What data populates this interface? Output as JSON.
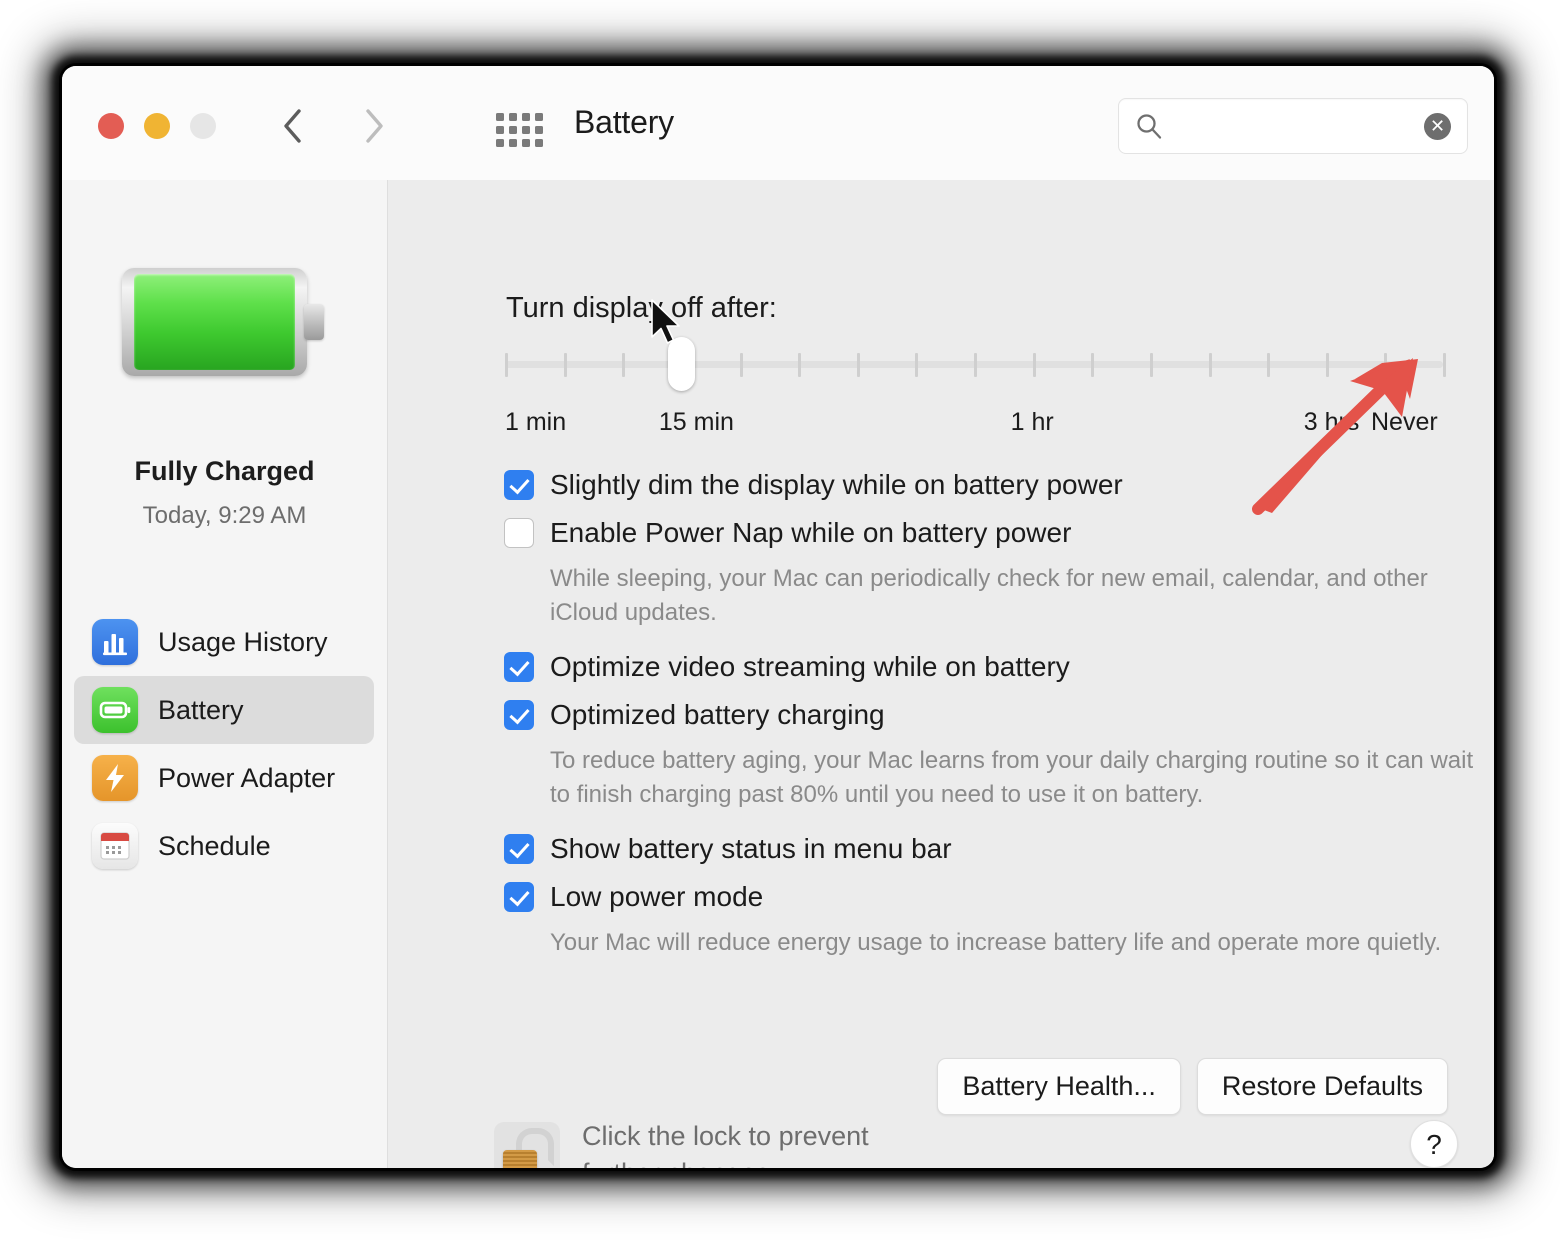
{
  "window": {
    "title": "Battery",
    "traffic_lights": [
      {
        "name": "close",
        "color": "#e35d54"
      },
      {
        "name": "minimize",
        "color": "#f0b433"
      },
      {
        "name": "zoom",
        "color": "#e6e6e6"
      }
    ]
  },
  "search": {
    "value": "",
    "placeholder": "",
    "clear_glyph": "✕"
  },
  "sidebar": {
    "status_title": "Fully Charged",
    "status_time": "Today, 9:29 AM",
    "items": [
      {
        "label": "Usage History",
        "icon": "chart-bars-icon",
        "selected": false
      },
      {
        "label": "Battery",
        "icon": "battery-icon",
        "selected": true
      },
      {
        "label": "Power Adapter",
        "icon": "bolt-icon",
        "selected": false
      },
      {
        "label": "Schedule",
        "icon": "calendar-icon",
        "selected": false
      }
    ]
  },
  "main": {
    "section_title": "Turn display off after:",
    "slider": {
      "tick_count": 16,
      "knob_tick_index": 3,
      "labels": [
        {
          "text": "1 min",
          "position": 0
        },
        {
          "text": "15 min",
          "position": 3
        },
        {
          "text": "1 hr",
          "position": 9
        },
        {
          "text": "3 hrs",
          "position": 14
        },
        {
          "text": "Never",
          "position": 16
        }
      ]
    },
    "options": [
      {
        "label": "Slightly dim the display while on battery power",
        "checked": true,
        "help": ""
      },
      {
        "label": "Enable Power Nap while on battery power",
        "checked": false,
        "help": "While sleeping, your Mac can periodically check for new email, calendar, and other iCloud updates."
      },
      {
        "label": "Optimize video streaming while on battery",
        "checked": true,
        "help": ""
      },
      {
        "label": "Optimized battery charging",
        "checked": true,
        "help": "To reduce battery aging, your Mac learns from your daily charging routine so it can wait to finish charging past 80% until you need to use it on battery."
      },
      {
        "label": "Show battery status in menu bar",
        "checked": true,
        "help": ""
      },
      {
        "label": "Low power mode",
        "checked": true,
        "help": "Your Mac will reduce energy usage to increase battery life and operate more quietly."
      }
    ],
    "buttons": [
      {
        "label": "Battery Health..."
      },
      {
        "label": "Restore Defaults"
      }
    ],
    "lock_text_line1": "Click the lock to prevent",
    "lock_text_line2": "further changes.",
    "help_glyph": "?"
  },
  "annotation": {
    "arrow_color": "#e4534a",
    "points_to": "Never"
  },
  "colors": {
    "accent": "#2f7ff0",
    "window_bg": "#ececec",
    "sidebar_bg": "#f5f5f5",
    "titlebar_bg": "#fbfbfb"
  }
}
